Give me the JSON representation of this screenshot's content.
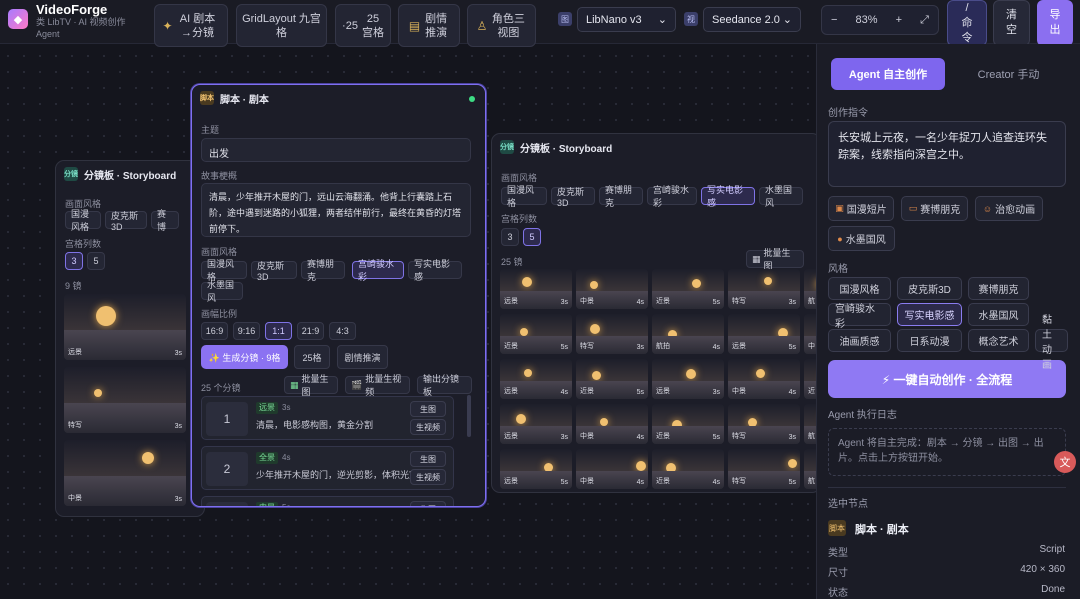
{
  "app": {
    "name": "VideoForge",
    "subtitle": "类 LibTV · AI 视频创作 Agent",
    "logo_icon": "◆"
  },
  "toolbar": {
    "ai_script": "AI 剧本→分镜",
    "grid_layout": "GridLayout 九宫格",
    "grid25_prefix": "·25",
    "grid25": "25宫格",
    "plot": "剧情推演",
    "character": "角色三视图",
    "image_tag": "图",
    "image_model": "LibNano v3",
    "video_tag": "视",
    "video_model": "Seedance 2.0",
    "zoom_out": "−",
    "zoom": "83%",
    "zoom_in": "+",
    "fit": "⤢",
    "command": "/ 命令",
    "clear": "清空",
    "export": "导出"
  },
  "right_panel": {
    "tab_agent": "Agent 自主创作",
    "tab_creator": "Creator 手动",
    "prompt_label": "创作指令",
    "prompt_text": "长安城上元夜，一名少年捉刀人追查连环失踪案，线索指向深宫之中。",
    "presets": [
      "国漫短片",
      "赛博朋克",
      "治愈动画",
      "水墨国风"
    ],
    "style_label": "风格",
    "styles": [
      "国漫风格",
      "皮克斯3D",
      "赛博朋克",
      "宫崎骏水彩",
      "写实电影感",
      "水墨国风",
      "油画质感",
      "日系动漫",
      "概念艺术",
      "黏土动画"
    ],
    "style_selected": "写实电影感",
    "run_button": "⚡ 一键自动创作 · 全流程",
    "log_label": "Agent 执行日志",
    "log_text": "Agent 将自主完成：剧本 → 分镜 → 出图 → 出片。点击上方按钮开始。",
    "selected_label": "选中节点",
    "selected_tag": "脚本",
    "selected_title": "脚本 · 剧本",
    "props": [
      {
        "k": "类型",
        "v": "Script"
      },
      {
        "k": "尺寸",
        "v": "420 × 360"
      },
      {
        "k": "状态",
        "v": "Done"
      }
    ]
  },
  "left_storyboard": {
    "tag": "分镜",
    "title": "分镜板 · Storyboard",
    "style_label": "画面风格",
    "styles": [
      "国漫风格",
      "皮克斯3D",
      "赛博"
    ],
    "cols_label": "宫格列数",
    "cols": [
      "3",
      "5"
    ],
    "count_label": "9 镜",
    "frames": [
      {
        "shot": "远景",
        "dur": "3s"
      },
      {
        "shot": "特写",
        "dur": "3s"
      },
      {
        "shot": "中景",
        "dur": "3s"
      }
    ]
  },
  "script_node": {
    "tag": "脚本",
    "title": "脚本 · 剧本",
    "topic_label": "主题",
    "topic_value": "出发",
    "synopsis_label": "故事梗概",
    "synopsis": "清晨，少年推开木屋的门，远山云海翻涌。他背上行囊踏上石阶，途中遇到迷路的小狐狸，两者结伴前行，最终在黄昏的灯塔前停下。",
    "style_label": "画面风格",
    "styles": [
      "国漫风格",
      "皮克斯3D",
      "赛博朋克",
      "宫崎骏水彩",
      "写实电影感",
      "水墨国风"
    ],
    "style_selected": "宫崎骏水彩",
    "ratio_label": "画幅比例",
    "ratios": [
      "16:9",
      "9:16",
      "1:1",
      "21:9",
      "4:3"
    ],
    "ratio_selected": "1:1",
    "gen_button": "✨ 生成分镜 · 9格",
    "grid25_button": "25格",
    "plot_button": "剧情推演",
    "shots_label": "25 个分镜",
    "batch_image": "批量生图",
    "batch_video": "批量生视频",
    "export_storyboard": "输出分镜板",
    "shots": [
      {
        "num": "1",
        "shot": "远景",
        "dur": "3s",
        "text": "清晨，电影感构图，黄金分割"
      },
      {
        "num": "2",
        "shot": "全景",
        "dur": "4s",
        "text": "少年推开木屋的门，逆光剪影，体积光穿透"
      },
      {
        "num": "3",
        "shot": "中景",
        "dur": "5s",
        "text": ""
      }
    ],
    "btn_image": "生图",
    "btn_video": "生视频"
  },
  "right_storyboard": {
    "tag": "分镜",
    "title": "分镜板 · Storyboard",
    "style_label": "画面风格",
    "styles": [
      "国漫风格",
      "皮克斯3D",
      "赛博朋克",
      "宫崎骏水彩",
      "写实电影感",
      "水墨国风"
    ],
    "style_selected": "写实电影感",
    "cols_label": "宫格列数",
    "cols": [
      "3",
      "5"
    ],
    "count_label": "25 镜",
    "batch_button": "批量生图",
    "rows": [
      [
        {
          "s": "远景",
          "d": "3s"
        },
        {
          "s": "中景",
          "d": "4s"
        },
        {
          "s": "近景",
          "d": "5s"
        },
        {
          "s": "特写",
          "d": "3s"
        },
        {
          "s": "航",
          "d": ""
        }
      ],
      [
        {
          "s": "近景",
          "d": "5s"
        },
        {
          "s": "特写",
          "d": "3s"
        },
        {
          "s": "航拍",
          "d": "4s"
        },
        {
          "s": "远景",
          "d": "5s"
        },
        {
          "s": "中",
          "d": ""
        }
      ],
      [
        {
          "s": "远景",
          "d": "4s"
        },
        {
          "s": "近景",
          "d": "5s"
        },
        {
          "s": "远景",
          "d": "3s"
        },
        {
          "s": "中景",
          "d": "4s"
        },
        {
          "s": "近",
          "d": ""
        }
      ],
      [
        {
          "s": "远景",
          "d": "3s"
        },
        {
          "s": "中景",
          "d": "4s"
        },
        {
          "s": "近景",
          "d": "5s"
        },
        {
          "s": "特写",
          "d": "3s"
        },
        {
          "s": "航",
          "d": ""
        }
      ],
      [
        {
          "s": "远景",
          "d": "5s"
        },
        {
          "s": "中景",
          "d": "4s"
        },
        {
          "s": "近景",
          "d": "4s"
        },
        {
          "s": "特写",
          "d": "5s"
        },
        {
          "s": "航",
          "d": ""
        }
      ]
    ]
  }
}
